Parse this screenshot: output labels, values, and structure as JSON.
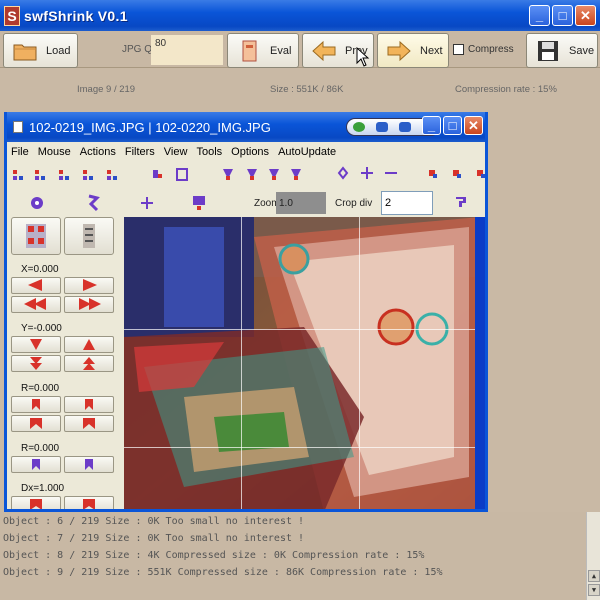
{
  "app": {
    "title": "swfShrink V0.1",
    "icon_letter": "S",
    "window_controls": {
      "minimize": "_",
      "maximize": "□",
      "close": "✕"
    }
  },
  "toolbar": {
    "load_label": "Load",
    "jpgq_label": "JPG Q=",
    "jpgq_value": "80",
    "eval_label": "Eval",
    "prev_label": "Prev",
    "next_label": "Next",
    "compress_label": "Compress",
    "compress_checked": false,
    "save_label": "Save"
  },
  "status": {
    "image": "Image 9 / 219",
    "size": "Size : 551K / 86K",
    "rate": "Compression rate : 15%"
  },
  "inner_window": {
    "title": "102-0219_IMG.JPG | 102-0220_IMG.JPG",
    "menu": [
      "File",
      "Mouse",
      "Actions",
      "Filters",
      "View",
      "Tools",
      "Options",
      "AutoUpdate"
    ],
    "zoom_label": "Zoom",
    "zoom_value": "1.0",
    "crop_label": "Crop div",
    "crop_value": "2",
    "x_label": "X=0.000",
    "y_label": "Y=-0.000",
    "r1_label": "R=0.000",
    "r2_label": "R=0.000",
    "dx_label": "Dx=1.000"
  },
  "log": [
    "Object : 6 / 219 Size : 0K Too small no interest !",
    "Object : 7 / 219 Size : 0K Too small no interest !",
    "Object : 8 / 219 Size : 4K Compressed size : 0K Compression rate : 15%",
    "Object : 9 / 219 Size : 551K Compressed size : 86K Compression rate : 15%"
  ],
  "colors": {
    "titlebar": "#0a55d8",
    "background": "#c9b9a5",
    "accent_red": "#d8322a",
    "accent_purple": "#6c3cc8"
  }
}
